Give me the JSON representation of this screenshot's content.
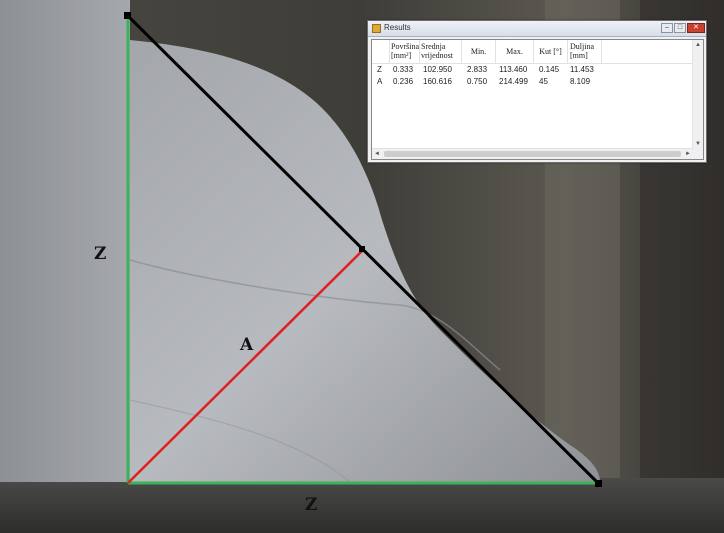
{
  "overlay_labels": {
    "left": "Z",
    "bottom": "Z",
    "diagonal": "A"
  },
  "window": {
    "title": "Results",
    "buttons": {
      "minimize": "–",
      "maximize": "□",
      "close": "✕"
    },
    "icon": "app-icon",
    "columns": [
      {
        "line1": "",
        "line2": ""
      },
      {
        "line1": "Površina",
        "line2": "[mm²]"
      },
      {
        "line1": "Srednja",
        "line2": "vrijednost"
      },
      {
        "line1": "Min.",
        "line2": ""
      },
      {
        "line1": "Max.",
        "line2": ""
      },
      {
        "line1": "Kut [°]",
        "line2": ""
      },
      {
        "line1": "Duljina",
        "line2": "[mm]"
      }
    ],
    "rows": [
      {
        "name": "Z",
        "area": "0.333",
        "mean": "102.950",
        "min": "2.833",
        "max": "113.460",
        "angle": "0.145",
        "length": "11.453"
      },
      {
        "name": "A",
        "area": "0.236",
        "mean": "160.616",
        "min": "0.750",
        "max": "214.499",
        "angle": "45",
        "length": "8.109"
      }
    ],
    "scroll_icons": {
      "up": "▲",
      "down": "▼",
      "left": "◄",
      "right": "►"
    }
  },
  "colors": {
    "leg_line": "#3bb35a",
    "hypotenuse": "#000000",
    "measure_line": "#e02020"
  }
}
